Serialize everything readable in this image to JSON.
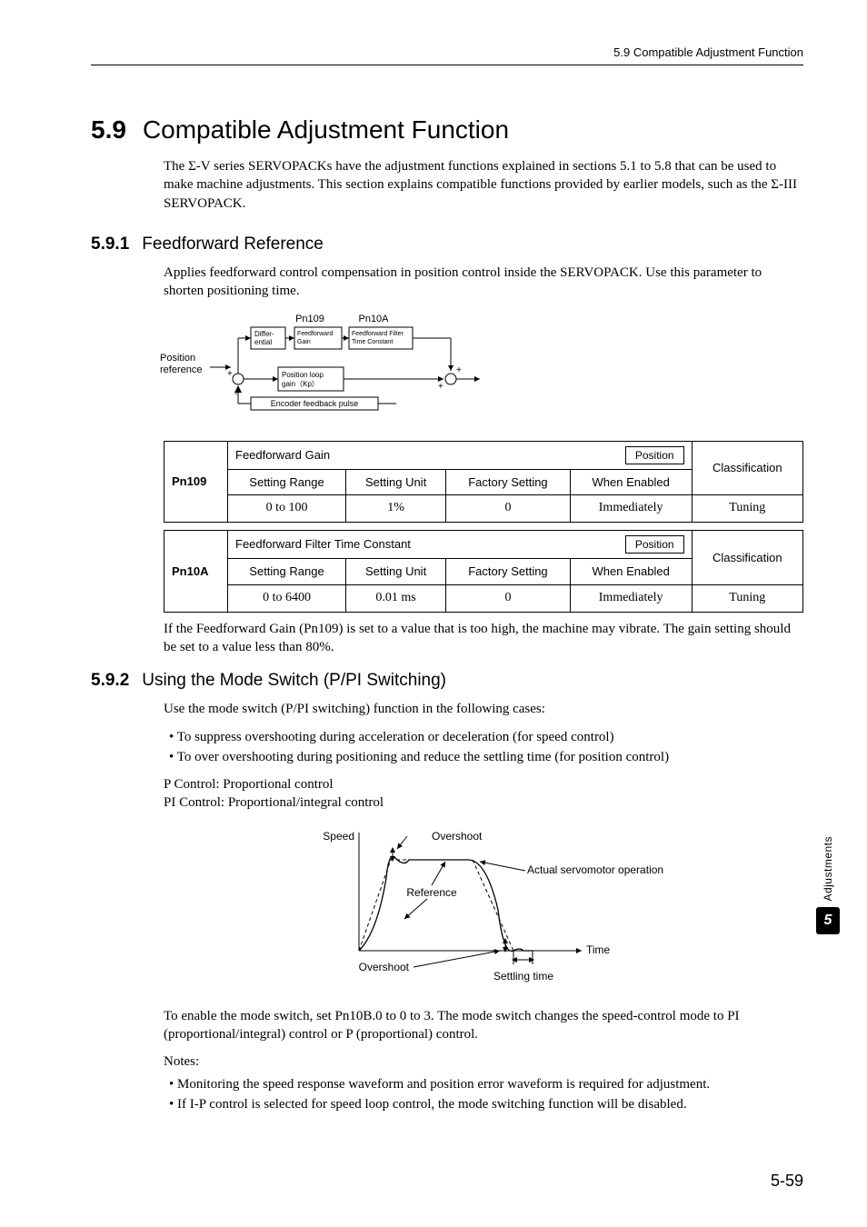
{
  "header": {
    "running": "5.9  Compatible Adjustment Function"
  },
  "section": {
    "num": "5.9",
    "title": "Compatible Adjustment Function",
    "intro": "The Σ-V series SERVOPACKs have the adjustment functions explained in sections 5.1 to 5.8 that can be used to make machine adjustments. This section explains compatible functions provided by earlier models, such as the Σ-III SERVOPACK."
  },
  "s591": {
    "num": "5.9.1",
    "title": "Feedforward Reference",
    "intro": "Applies feedforward control compensation in position control inside the SERVOPACK. Use this parameter to shorten positioning time.",
    "diagram": {
      "pos_ref": "Position\nreference",
      "pn109": "Pn109",
      "pn10a": "Pn10A",
      "diff": "Differ-\nential",
      "ffgain": "Feedforward\nGain",
      "fffilt": "Feedforward Filter\nTime Constant",
      "ploop": "Position loop\ngain（Kp）",
      "enc": "Encoder feedback pulse"
    },
    "table109": {
      "pn": "Pn109",
      "name": "Feedforward Gain",
      "mode": "Position",
      "class_label": "Classification",
      "cols": {
        "range": "Setting Range",
        "unit": "Setting Unit",
        "factory": "Factory Setting",
        "enabled": "When Enabled"
      },
      "vals": {
        "range": "0 to 100",
        "unit": "1%",
        "factory": "0",
        "enabled": "Immediately",
        "class": "Tuning"
      }
    },
    "table10a": {
      "pn": "Pn10A",
      "name": "Feedforward Filter Time Constant",
      "mode": "Position",
      "class_label": "Classification",
      "cols": {
        "range": "Setting Range",
        "unit": "Setting Unit",
        "factory": "Factory Setting",
        "enabled": "When Enabled"
      },
      "vals": {
        "range": "0 to 6400",
        "unit": "0.01 ms",
        "factory": "0",
        "enabled": "Immediately",
        "class": "Tuning"
      }
    },
    "note": "If the Feedforward Gain (Pn109) is set to a value that is too high, the machine may vibrate. The gain setting should be set to a value less than 80%."
  },
  "s592": {
    "num": "5.9.2",
    "title": "Using the Mode Switch (P/PI Switching)",
    "intro": "Use the mode switch (P/PI switching) function in the following cases:",
    "bullets": [
      "To suppress overshooting during acceleration or deceleration (for speed control)",
      "To over overshooting during positioning and reduce the settling time (for position control)"
    ],
    "defs": [
      "P Control: Proportional control",
      "PI Control: Proportional/integral control"
    ],
    "graph": {
      "speed": "Speed",
      "overshoot": "Overshoot",
      "actual": "Actual servomotor operation",
      "reference": "Reference",
      "time": "Time",
      "settling": "Settling time"
    },
    "para": "To enable the mode switch, set Pn10B.0 to 0 to 3. The mode switch changes the speed-control mode to PI (proportional/integral) control or P (proportional) control.",
    "notes_label": "Notes:",
    "notes": [
      "Monitoring the speed response waveform and position error waveform is required for adjustment.",
      "If I-P control is selected for speed loop control, the mode switching function will be disabled."
    ]
  },
  "tab": {
    "label": "Adjustments",
    "num": "5"
  },
  "page_num": "5-59"
}
